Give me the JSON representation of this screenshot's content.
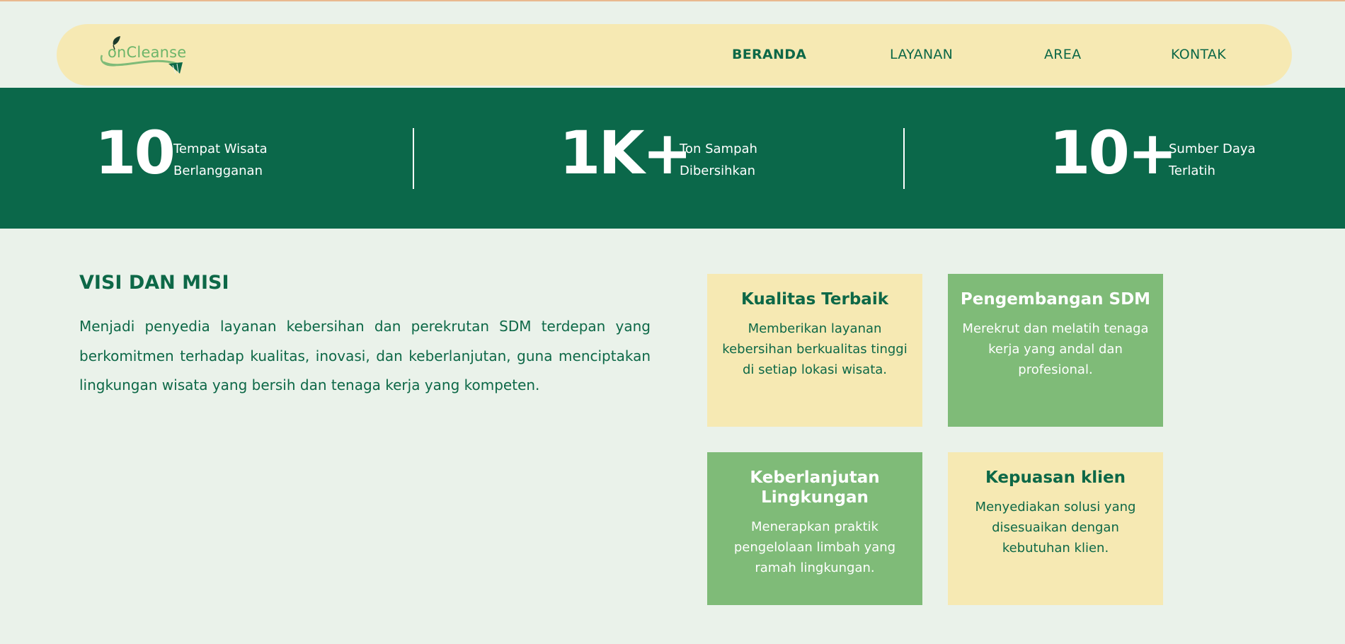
{
  "brand": {
    "logo_text": "onCleanse"
  },
  "nav": {
    "items": [
      {
        "label": "BERANDA",
        "active": true
      },
      {
        "label": "LAYANAN",
        "active": false
      },
      {
        "label": "AREA",
        "active": false
      },
      {
        "label": "KONTAK",
        "active": false
      }
    ]
  },
  "stats": [
    {
      "value": "10",
      "label_line1": "Tempat Wisata",
      "label_line2": "Berlangganan"
    },
    {
      "value": "1K+",
      "label_line1": "Ton Sampah",
      "label_line2": "Dibersihkan"
    },
    {
      "value": "10+",
      "label_line1": "Sumber Daya",
      "label_line2": "Terlatih"
    }
  ],
  "visi": {
    "title": "VISI DAN MISI",
    "text": "Menjadi penyedia layanan kebersihan dan perekrutan SDM terdepan yang berkomitmen terhadap kualitas, inovasi, dan keberlanjutan, guna menciptakan lingkungan wisata yang bersih dan tenaga kerja yang kompeten."
  },
  "cards": [
    {
      "title": "Kualitas Terbaik",
      "desc": "Memberikan layanan kebersihan berkualitas tinggi di setiap lokasi wisata."
    },
    {
      "title": "Pengembangan SDM",
      "desc": "Merekrut dan melatih tenaga kerja yang andal dan profesional."
    },
    {
      "title": "Keberlanjutan Lingkungan",
      "desc": "Menerapkan praktik pengelolaan limbah yang ramah lingkungan."
    },
    {
      "title": "Kepuasan klien",
      "desc": "Menyediakan solusi yang disesuaikan dengan kebutuhan klien."
    }
  ],
  "colors": {
    "primary_green": "#0b684a",
    "light_green": "#7fbb78",
    "cream": "#f6e9b3",
    "background": "#eaf2ea"
  }
}
